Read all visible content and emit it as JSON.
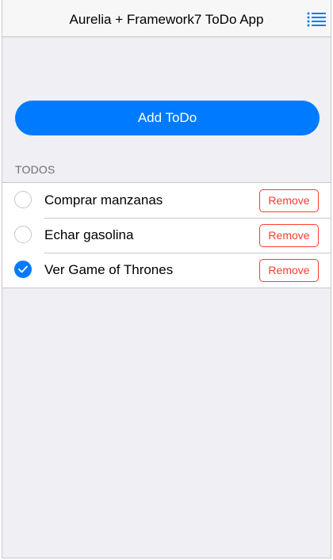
{
  "navbar": {
    "title": "Aurelia + Framework7 ToDo App",
    "menu_icon": "list-menu-icon"
  },
  "actions": {
    "add_label": "Add ToDo"
  },
  "todos": {
    "section_title": "TODOS",
    "remove_label": "Remove",
    "items": [
      {
        "text": "Comprar manzanas",
        "done": false
      },
      {
        "text": "Echar gasolina",
        "done": false
      },
      {
        "text": "Ver Game of Thrones",
        "done": true
      }
    ]
  },
  "colors": {
    "accent": "#007aff",
    "danger": "#ff3b30",
    "background": "#efeff4"
  }
}
